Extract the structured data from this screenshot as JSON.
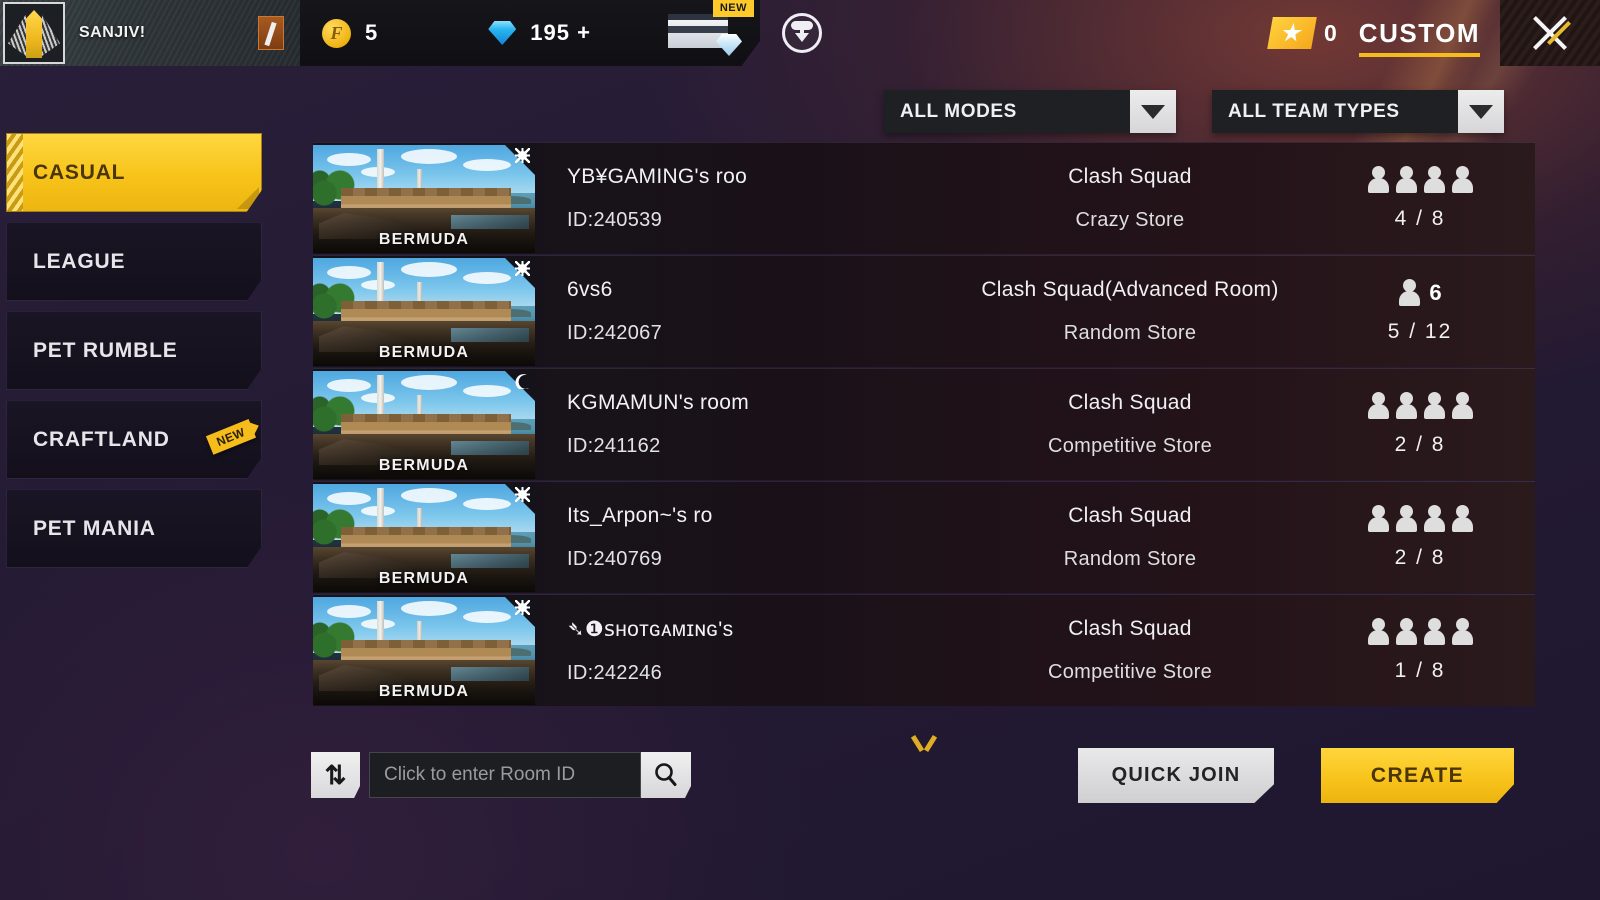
{
  "header": {
    "player_name": "SANJIV!",
    "avatar_icon": "blade-feather-icon",
    "rank_badge_icon": "rank-icon",
    "coin_icon": "ff-coin-icon",
    "coin_value": "5",
    "diamond_icon": "diamond-icon",
    "diamond_value": "195 +",
    "store_icon": "diamond-store-icon",
    "store_badge": "NEW",
    "download_icon": "download-cloud-icon",
    "ticket_icon": "custom-ticket-icon",
    "ticket_count": "0",
    "mode_label": "CUSTOM",
    "close_icon": "close-icon"
  },
  "sidebar": {
    "items": [
      {
        "label": "CASUAL",
        "active": true,
        "badge": ""
      },
      {
        "label": "LEAGUE",
        "active": false,
        "badge": ""
      },
      {
        "label": "PET RUMBLE",
        "active": false,
        "badge": ""
      },
      {
        "label": "CRAFTLAND",
        "active": false,
        "badge": "NEW"
      },
      {
        "label": "PET MANIA",
        "active": false,
        "badge": ""
      }
    ]
  },
  "filters": [
    {
      "name": "mode-filter",
      "value": "ALL MODES",
      "icon": "chevron-down-icon"
    },
    {
      "name": "team-filter",
      "value": "ALL TEAM TYPES",
      "icon": "chevron-down-icon"
    }
  ],
  "rooms": [
    {
      "map": "BERMUDA",
      "time_icon": "sun-icon",
      "name": "YB¥GAMING's roo",
      "id": "ID:240539",
      "mode": "Clash Squad",
      "store": "Crazy Store",
      "player_icons": 4,
      "single_icon_value": "",
      "count": "4 / 8"
    },
    {
      "map": "BERMUDA",
      "time_icon": "sun-icon",
      "name": "6vs6",
      "id": "ID:242067",
      "mode": "Clash Squad(Advanced Room)",
      "store": "Random Store",
      "player_icons": 1,
      "single_icon_value": "6",
      "count": "5 / 12"
    },
    {
      "map": "BERMUDA",
      "time_icon": "moon-icon",
      "name": "KGMAMUN's room",
      "id": "ID:241162",
      "mode": "Clash Squad",
      "store": "Competitive Store",
      "player_icons": 4,
      "single_icon_value": "",
      "count": "2 / 8"
    },
    {
      "map": "BERMUDA",
      "time_icon": "sun-icon",
      "name": "Its_Arpon~'s ro",
      "id": "ID:240769",
      "mode": "Clash Squad",
      "store": "Random Store",
      "player_icons": 4,
      "single_icon_value": "",
      "count": "2 / 8"
    },
    {
      "map": "BERMUDA",
      "time_icon": "sun-icon",
      "name": "➴❶ꜱʜᴏᴛɢᴀᴍɪɴɢ's",
      "id": "ID:242246",
      "mode": "Clash Squad",
      "store": "Competitive Store",
      "player_icons": 4,
      "single_icon_value": "",
      "count": "1 / 8"
    }
  ],
  "bottom": {
    "refresh_icon": "refresh-icon",
    "room_id_placeholder": "Click to enter Room ID",
    "room_id_value": "",
    "search_icon": "search-icon",
    "scroll_icon": "chevron-down-icon",
    "quick_join_label": "QUICK JOIN",
    "create_label": "CREATE"
  },
  "colors": {
    "accent_yellow": "#f7c31a",
    "panel_dark": "#15131a",
    "background": "#241a33",
    "diamond_blue": "#29b6f0"
  }
}
